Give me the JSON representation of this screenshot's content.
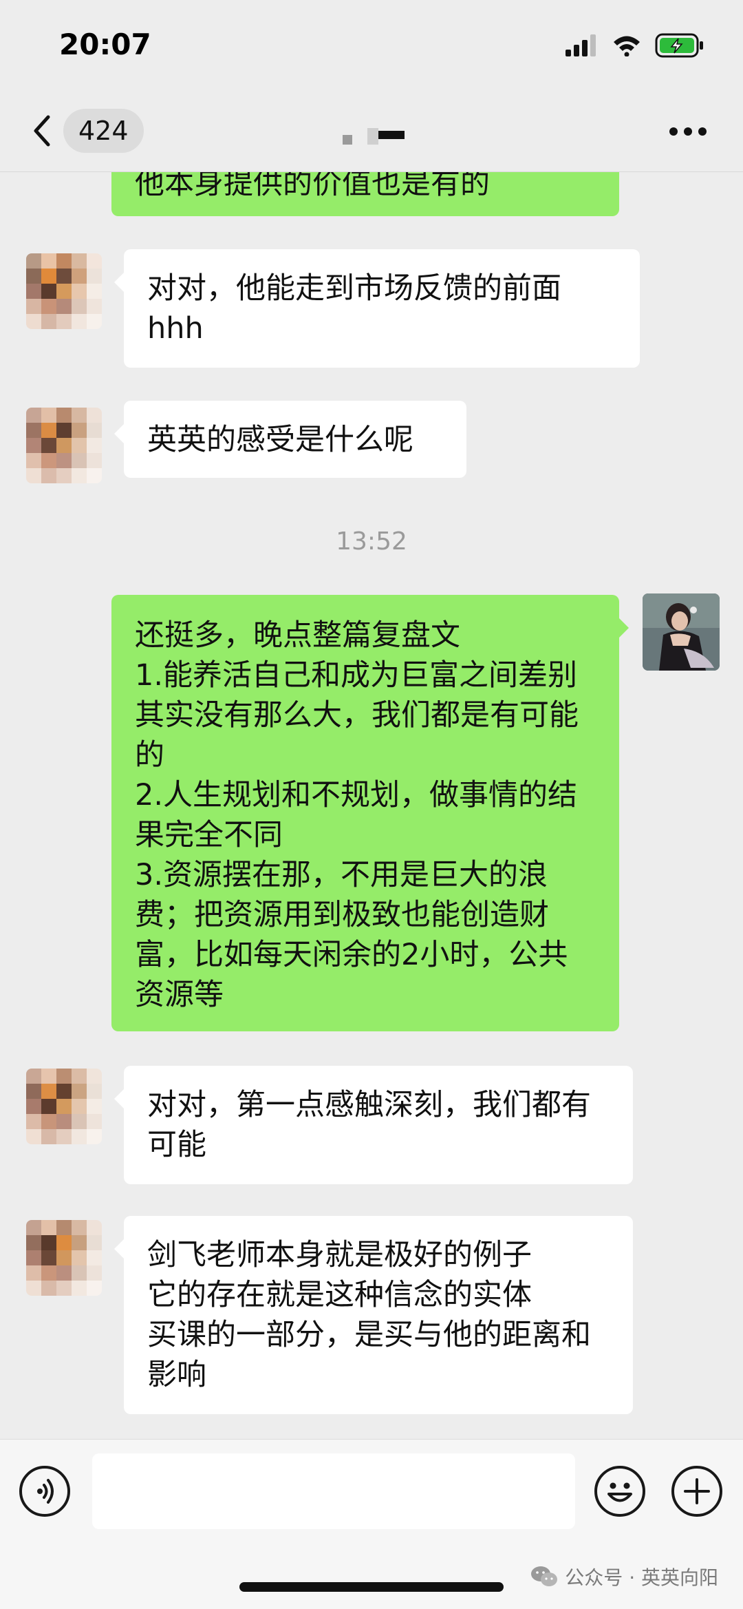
{
  "status_bar": {
    "time": "20:07",
    "battery_color": "#2dbb3b"
  },
  "nav": {
    "unread_count": "424",
    "back_icon": "chevron-left-icon",
    "more_icon": "more-dots-icon"
  },
  "messages": [
    {
      "side": "out",
      "text": "他本身提供的价值也是有的"
    },
    {
      "side": "in",
      "text": "对对，他能走到市场反馈的前面\nhhh"
    },
    {
      "side": "in",
      "text": "英英的感受是什么呢"
    },
    {
      "side": "out",
      "text": "还挺多，晚点整篇复盘文\n1.能养活自己和成为巨富之间差别其实没有那么大，我们都是有可能的\n2.人生规划和不规划，做事情的结果完全不同\n3.资源摆在那，不用是巨大的浪费；把资源用到极致也能创造财富，比如每天闲余的2小时，公共资源等"
    },
    {
      "side": "in",
      "text": "对对，第一点感触深刻，我们都有可能"
    },
    {
      "side": "in",
      "text": "剑飞老师本身就是极好的例子\n它的存在就是这种信念的实体\n买课的一部分，是买与他的距离和影响"
    }
  ],
  "timestamp": "13:52",
  "composer": {
    "voice_icon": "voice-icon",
    "emoji_icon": "emoji-icon",
    "plus_icon": "plus-icon",
    "input_value": ""
  },
  "watermark": {
    "text": "公众号 · 英英向阳"
  },
  "colors": {
    "background": "#ededed",
    "bubble_out": "#95ec69",
    "bubble_in": "#ffffff",
    "timestamp": "#9a9a9a"
  }
}
